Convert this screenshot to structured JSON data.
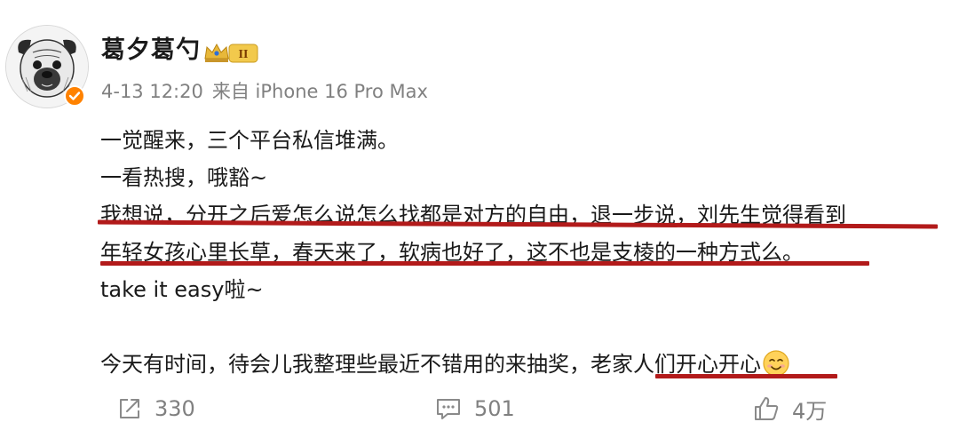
{
  "user": {
    "name": "葛夕葛勺",
    "badge_level": "II",
    "verified": true
  },
  "post": {
    "date": "4-13 12:20",
    "source": "来自 iPhone 16 Pro Max",
    "lines": [
      "一觉醒来，三个平台私信堆满。",
      "一看热搜，哦豁~",
      "我想说，分开之后爱怎么说怎么找都是对方的自由，退一步说，刘先生觉得看到",
      "年轻女孩心里长草，春天来了，软病也好了，这不也是支棱的一种方式么。",
      "take it easy啦~",
      "",
      "今天有时间，待会儿我整理些最近不错用的来抽奖，老家人们开心开心"
    ],
    "last_line_emoji": "smiling-face-emoji"
  },
  "actions": {
    "repost_count": "330",
    "comment_count": "501",
    "like_count": "4万"
  },
  "colors": {
    "annotation_red": "#b21a1a",
    "verified_orange": "#ff8200",
    "meta_gray": "#808080",
    "badge_gold": "#d9a92c"
  }
}
